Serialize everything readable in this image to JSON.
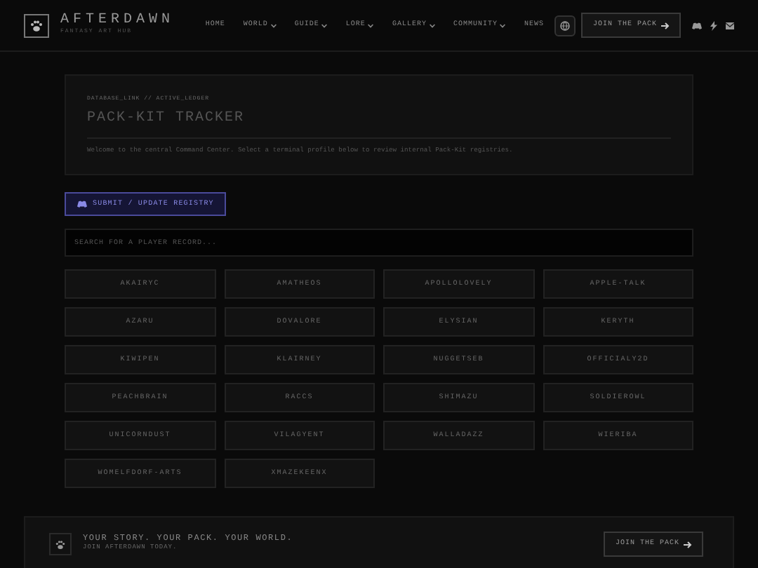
{
  "brand": {
    "name": "AFTERDAWN",
    "tagline": "FANTASY ART HUB"
  },
  "nav": [
    {
      "label": "HOME",
      "dropdown": false
    },
    {
      "label": "WORLD",
      "dropdown": true
    },
    {
      "label": "GUIDE",
      "dropdown": true
    },
    {
      "label": "LORE",
      "dropdown": true
    },
    {
      "label": "GALLERY",
      "dropdown": true
    },
    {
      "label": "COMMUNITY",
      "dropdown": true
    },
    {
      "label": "NEWS",
      "dropdown": false
    }
  ],
  "join_button": "JOIN THE PACK",
  "hero": {
    "breadcrumb": "DATABASE_LINK // ACTIVE_LEDGER",
    "title": "PACK-KIT TRACKER",
    "description": "Welcome to the central Command Center. Select a terminal profile below to review internal Pack-Kit registries."
  },
  "submit_button": "SUBMIT / UPDATE REGISTRY",
  "search": {
    "placeholder": "SEARCH FOR A PLAYER RECORD..."
  },
  "players": [
    "AKAIRYC",
    "AMATHEOS",
    "APOLLOLOVELY",
    "APPLE-TALK",
    "AZARU",
    "DOVALORE",
    "ELYSIAN",
    "KERYTH",
    "KIWIPEN",
    "KLAIRNEY",
    "NUGGETSEB",
    "OFFICIALY2D",
    "PEACHBRAIN",
    "RACCS",
    "SHIMAZU",
    "SOLDIEROWL",
    "UNICORNDUST",
    "VILAGYENT",
    "WALLADAZZ",
    "WIERIBA",
    "WOMELFDORF-ARTS",
    "XMAZEKEENX"
  ],
  "footer": {
    "headline": "YOUR STORY. YOUR PACK. YOUR WORLD.",
    "subline": "JOIN AFTERDAWN TODAY.",
    "button": "JOIN THE PACK"
  }
}
